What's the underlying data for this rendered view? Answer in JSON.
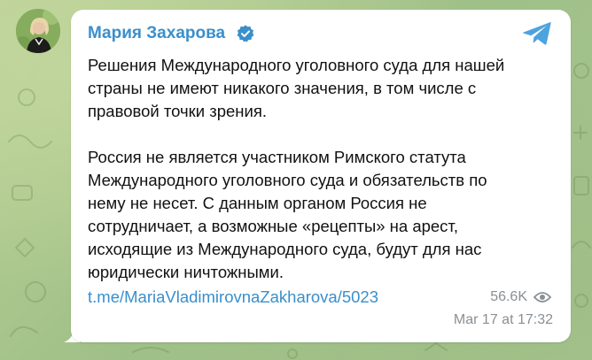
{
  "post": {
    "author": "Мария Захарова",
    "verified": true,
    "paragraphs": [
      [
        "Решения Международного уголовного суда для нашей",
        "страны не имеют никакого значения, в том числе с",
        "правовой точки зрения."
      ],
      [
        "Россия не является участником Римского статута",
        "Международного уголовного суда и обязательств по",
        "нему не несет. С данным органом Россия не",
        "сотрудничает, а возможные «рецепты» на арест,",
        "исходящие из Международного суда, будут для нас",
        "юридически ничтожными."
      ]
    ],
    "link": "t.me/MariaVladimirovnaZakharova/5023",
    "views": "56.6K",
    "timestamp": "Mar 17 at 17:32"
  },
  "icons": {
    "verified": "verified-badge-icon",
    "share": "telegram-paper-plane-icon",
    "views": "eye-icon"
  },
  "colors": {
    "accent": "#3a8fcc",
    "text": "#111111",
    "meta": "#8a8f94",
    "bubble": "#ffffff",
    "background": "#a7c48c"
  }
}
